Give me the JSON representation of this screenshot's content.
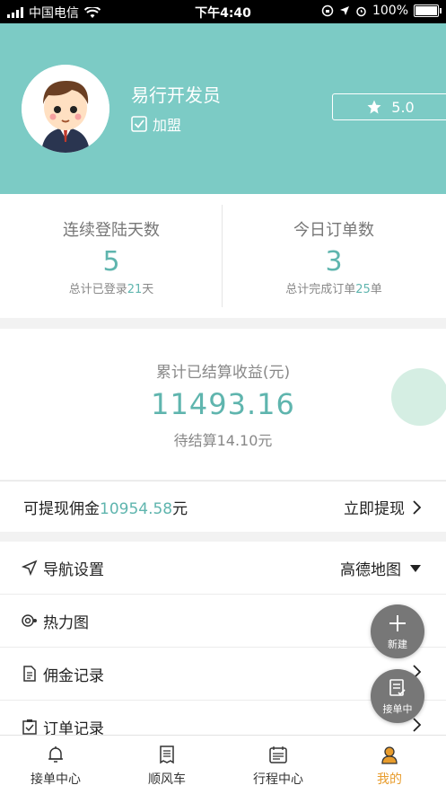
{
  "status_bar": {
    "carrier": "中国电信",
    "time": "下午4:40",
    "battery": "100%"
  },
  "profile": {
    "name": "易行开发员",
    "join_label": "加盟",
    "rating": "5.0"
  },
  "stats": [
    {
      "title": "连续登陆天数",
      "value": "5",
      "sub_prefix": "总计已登录",
      "sub_value": "21",
      "sub_suffix": "天"
    },
    {
      "title": "今日订单数",
      "value": "3",
      "sub_prefix": "总计完成订单",
      "sub_value": "25",
      "sub_suffix": "单"
    }
  ],
  "earnings": {
    "title": "累计已结算收益(元)",
    "amount": "11493.16",
    "pending": "待结算14.10元"
  },
  "withdraw": {
    "label_prefix": "可提现佣金",
    "amount": "10954.58",
    "label_suffix": "元",
    "action": "立即提现"
  },
  "menu": [
    {
      "label": "导航设置",
      "value": "高德地图"
    },
    {
      "label": "热力图"
    },
    {
      "label": "佣金记录"
    },
    {
      "label": "订单记录"
    }
  ],
  "fabs": {
    "new": "新建",
    "accepting": "接单中"
  },
  "tabs": [
    {
      "label": "接单中心"
    },
    {
      "label": "顺风车"
    },
    {
      "label": "行程中心"
    },
    {
      "label": "我的"
    }
  ],
  "colors": {
    "header": "#7ccbc5",
    "accent": "#5fb5ae",
    "active_tab": "#e89c2c"
  }
}
